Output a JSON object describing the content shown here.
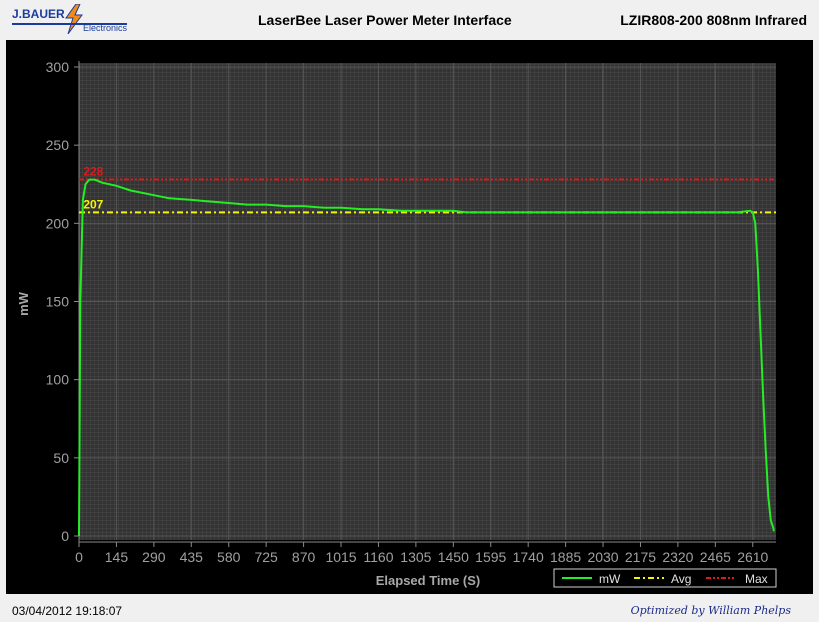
{
  "header": {
    "logo_top": "J.BAUER",
    "logo_bottom": "Electronics",
    "title": "LaserBee Laser Power Meter Interface",
    "model": "LZIR808-200 808nm Infrared"
  },
  "footer": {
    "timestamp": "03/04/2012 19:18:07",
    "credit": "Optimized by William Phelps"
  },
  "colors": {
    "mw": "#22ee22",
    "avg": "#f5f500",
    "max": "#e01818",
    "plot_bg": "#3c3c3c",
    "axis_text": "#a0a0a0"
  },
  "chart_data": {
    "type": "line",
    "xlabel": "Elapsed Time (S)",
    "ylabel": "mW",
    "xlim": [
      0,
      2700
    ],
    "ylim": [
      0,
      300
    ],
    "x_ticks": [
      0,
      145,
      290,
      435,
      580,
      725,
      870,
      1015,
      1160,
      1305,
      1450,
      1595,
      1740,
      1885,
      2030,
      2175,
      2320,
      2465,
      2610
    ],
    "y_ticks": [
      0,
      50,
      100,
      150,
      200,
      250,
      300
    ],
    "grid": true,
    "legend": {
      "position": "bottom-right",
      "entries": [
        "mW",
        "Avg",
        "Max"
      ]
    },
    "series": [
      {
        "name": "mW",
        "style": "solid",
        "x": [
          0,
          5,
          15,
          25,
          40,
          60,
          90,
          145,
          200,
          290,
          350,
          435,
          500,
          580,
          650,
          725,
          800,
          870,
          950,
          1015,
          1100,
          1160,
          1250,
          1305,
          1400,
          1450,
          1500,
          1595,
          1700,
          1740,
          1800,
          1885,
          2000,
          2030,
          2100,
          2175,
          2250,
          2320,
          2400,
          2465,
          2550,
          2600,
          2610,
          2620,
          2630,
          2640,
          2650,
          2660,
          2670,
          2680,
          2690,
          2692
        ],
        "y": [
          0,
          150,
          215,
          225,
          228,
          228,
          226,
          224,
          221,
          218,
          216,
          215,
          214,
          213,
          212,
          212,
          211,
          211,
          210,
          210,
          209,
          209,
          208,
          208,
          208,
          208,
          207,
          207,
          207,
          207,
          207,
          207,
          207,
          207,
          207,
          207,
          207,
          207,
          207,
          207,
          207,
          208,
          207,
          200,
          170,
          130,
          90,
          55,
          25,
          10,
          5,
          3
        ]
      },
      {
        "name": "Avg",
        "style": "dashdot",
        "value": 207
      },
      {
        "name": "Max",
        "style": "dashdotdot",
        "value": 228
      }
    ],
    "annotations": [
      {
        "text": "228",
        "y": 228,
        "x": 40,
        "color": "max"
      },
      {
        "text": "207",
        "y": 207,
        "x": 40,
        "color": "avg"
      }
    ]
  }
}
